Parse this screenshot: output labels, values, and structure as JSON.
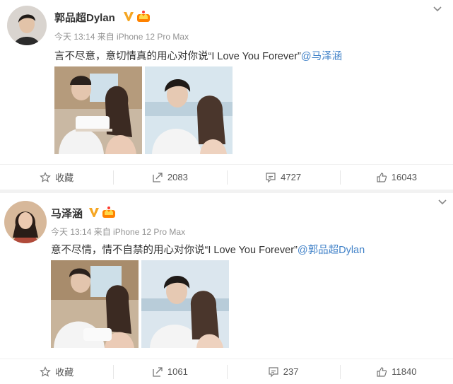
{
  "posts": [
    {
      "username": "郭品超Dylan",
      "meta": "今天 13:14 来自 iPhone 12 Pro Max",
      "text": "言不尽意，意切情真的用心对你说“I Love You Forever”",
      "mention": "@马泽涵",
      "actions": {
        "favorite": "收藏",
        "repost": "2083",
        "comment": "4727",
        "like": "16043"
      }
    },
    {
      "username": "马泽涵",
      "meta": "今天 13:14 来自 iPhone 12 Pro Max",
      "text": "意不尽情，情不自禁的用心对你说“I Love You Forever”",
      "mention": "@郭品超Dylan",
      "actions": {
        "favorite": "收藏",
        "repost": "1061",
        "comment": "237",
        "like": "11840"
      }
    }
  ],
  "colors": {
    "mention": "#4182c8",
    "meta": "#939393",
    "verified": "#f5a623",
    "crown": "#ff8200"
  },
  "icons": [
    "verified-badge-icon",
    "vip-crown-icon",
    "chevron-down-icon",
    "star-icon",
    "repost-icon",
    "comment-icon",
    "like-icon"
  ]
}
